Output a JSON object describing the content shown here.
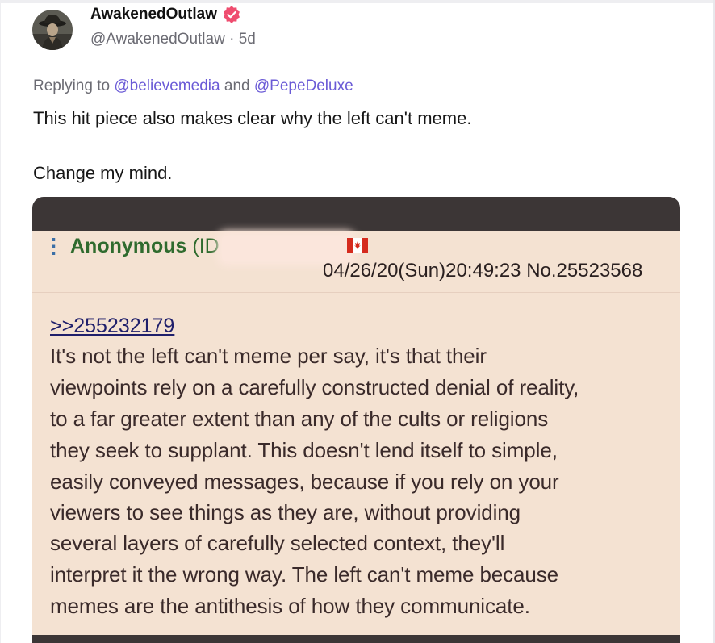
{
  "post": {
    "author_name": "AwakenedOutlaw",
    "handle": "@AwakenedOutlaw",
    "separator": "·",
    "age": "5d",
    "verified_icon": "verified-badge-icon",
    "badge_color": "#ef4d6f",
    "reply": {
      "prefix": "Replying to",
      "mention_1": "@believemedia",
      "conjunction": "and",
      "mention_2": "@PepeDeluxe"
    },
    "text_lines": [
      "This hit piece also makes clear why the left can't meme.",
      "Change my mind."
    ]
  },
  "media": {
    "board_post": {
      "poster": "Anonymous",
      "id_label": "(ID",
      "flag_icon": "canada-flag-icon",
      "datetime": "04/26/20(Sun)20:49:23",
      "post_number": "No.25523568",
      "quote_link": ">>255232179",
      "body_lines": [
        "It's not the left can't meme per say, it's that their",
        "viewpoints rely on a carefully constructed denial of reality,",
        "to a far greater extent than any of the cults or religions",
        "they seek to supplant. This doesn't lend itself to simple,",
        "easily conveyed messages, because if you rely on your",
        "viewers to see things as they are, without providing",
        "several layers of carefully selected context, they'll",
        "interpret it the wrong way. The left can't meme because",
        "memes are the antithesis of how they communicate."
      ]
    }
  },
  "colors": {
    "mention": "#6a5ad6",
    "chan_background": "#f4e2d2",
    "chan_name": "#2f6b2e",
    "media_frame": "#3c3636"
  }
}
